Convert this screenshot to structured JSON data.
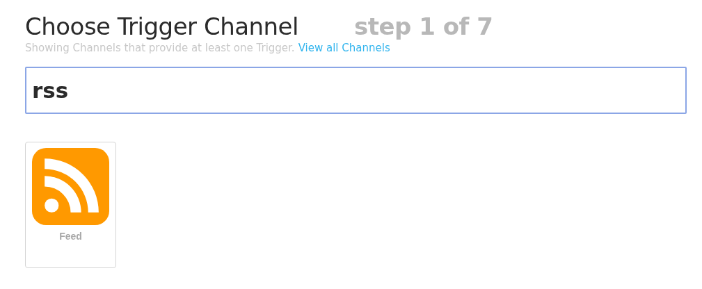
{
  "header": {
    "title": "Choose Trigger Channel",
    "step": "step 1 of 7",
    "subtitle": "Showing Channels that provide at least one Trigger.",
    "link": "View all Channels"
  },
  "search": {
    "value": "rss"
  },
  "channels": [
    {
      "name": "Feed",
      "color": "#ff9900"
    }
  ]
}
